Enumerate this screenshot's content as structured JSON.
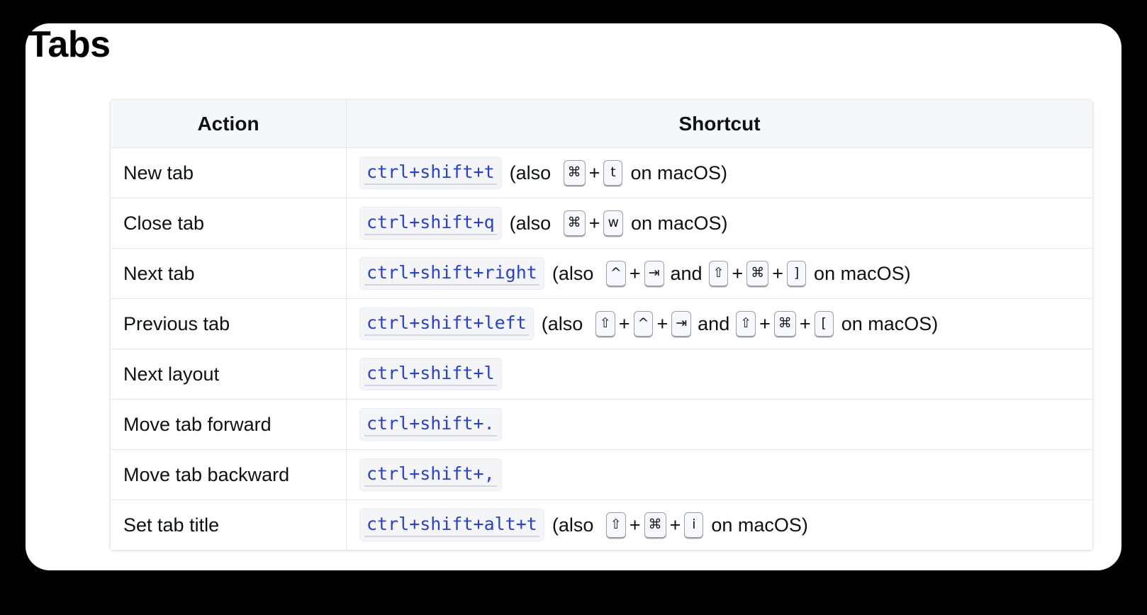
{
  "page": {
    "title": "Tabs",
    "background_color": "#000000",
    "card_color": "#ffffff"
  },
  "colors": {
    "code_text": "#2740d9",
    "code_background": "#f3f5f9",
    "header_background": "#f5f7fa",
    "border": "#e4e6e8",
    "key_border": "#9aa0a6",
    "text": "#0f1013"
  },
  "table": {
    "columns": [
      "Action",
      "Shortcut"
    ],
    "rows": [
      {
        "action": "New tab",
        "code": "ctrl+shift+t",
        "note_open": "(also",
        "keys": [
          "⌘",
          "t"
        ],
        "separators": [
          "+"
        ],
        "note_close": "on macOS)"
      },
      {
        "action": "Close tab",
        "code": "ctrl+shift+q",
        "note_open": "(also",
        "keys": [
          "⌘",
          "w"
        ],
        "separators": [
          "+"
        ],
        "note_close": "on macOS)"
      },
      {
        "action": "Next tab",
        "code": "ctrl+shift+right",
        "note_open": "(also",
        "keys": [
          "^",
          "⇥",
          "⇧",
          "⌘",
          "]"
        ],
        "separators": [
          "+",
          "and",
          "+",
          "+"
        ],
        "note_close": "on macOS)"
      },
      {
        "action": "Previous tab",
        "code": "ctrl+shift+left",
        "note_open": "(also",
        "keys": [
          "⇧",
          "^",
          "⇥",
          "⇧",
          "⌘",
          "["
        ],
        "separators": [
          "+",
          "+",
          "and",
          "+",
          "+"
        ],
        "note_close": "on macOS)"
      },
      {
        "action": "Next layout",
        "code": "ctrl+shift+l",
        "note_open": "",
        "keys": [],
        "separators": [],
        "note_close": ""
      },
      {
        "action": "Move tab forward",
        "code": "ctrl+shift+.",
        "note_open": "",
        "keys": [],
        "separators": [],
        "note_close": ""
      },
      {
        "action": "Move tab backward",
        "code": "ctrl+shift+,",
        "note_open": "",
        "keys": [],
        "separators": [],
        "note_close": ""
      },
      {
        "action": "Set tab title",
        "code": "ctrl+shift+alt+t",
        "note_open": "(also",
        "keys": [
          "⇧",
          "⌘",
          "i"
        ],
        "separators": [
          "+",
          "+"
        ],
        "note_close": "on macOS)"
      }
    ]
  }
}
